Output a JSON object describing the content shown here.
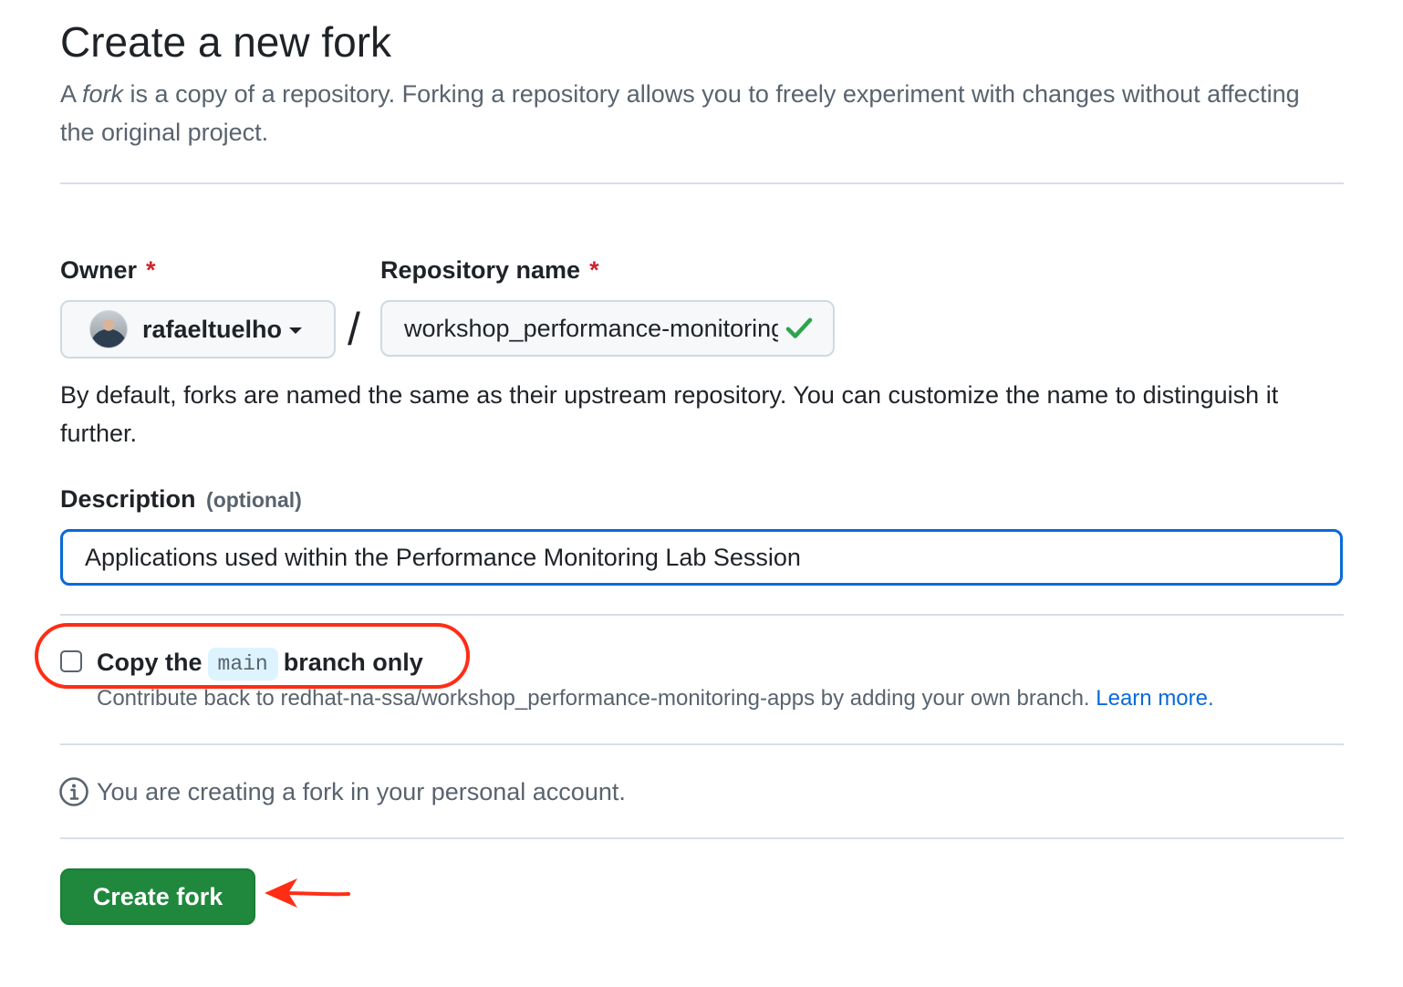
{
  "header": {
    "title": "Create a new fork",
    "subtitle_prefix": "A ",
    "subtitle_em": "fork",
    "subtitle_rest": " is a copy of a repository. Forking a repository allows you to freely experiment with changes without affecting the original project."
  },
  "form": {
    "owner_label": "Owner",
    "owner_required": "*",
    "owner_value": "rafaeltuelho",
    "separator": "/",
    "repo_label": "Repository name",
    "repo_required": "*",
    "repo_value": "workshop_performance-monitoring-apps",
    "repo_help": "By default, forks are named the same as their upstream repository. You can customize the name to distinguish it further.",
    "description_label": "Description",
    "description_optional": "(optional)",
    "description_value": "Applications used within the Performance Monitoring Lab Session"
  },
  "branch_option": {
    "label_prefix": "Copy the",
    "branch_name": "main",
    "label_suffix": "branch only",
    "checked": false,
    "note": "Contribute back to redhat-na-ssa/workshop_performance-monitoring-apps by adding your own branch.",
    "learn_more": "Learn more."
  },
  "info": {
    "text": "You are creating a fork in your personal account."
  },
  "actions": {
    "create_label": "Create fork"
  },
  "colors": {
    "primary_button": "#1f883d",
    "focus_border": "#0969da",
    "annotation_red": "#ff2d15",
    "valid_check": "#1a7f37",
    "link": "#0969da"
  },
  "icons": {
    "owner_dropdown": "chevron-down-icon",
    "repo_valid": "check-icon",
    "info": "info-icon",
    "annotation_arrow": "arrow-left-icon"
  }
}
